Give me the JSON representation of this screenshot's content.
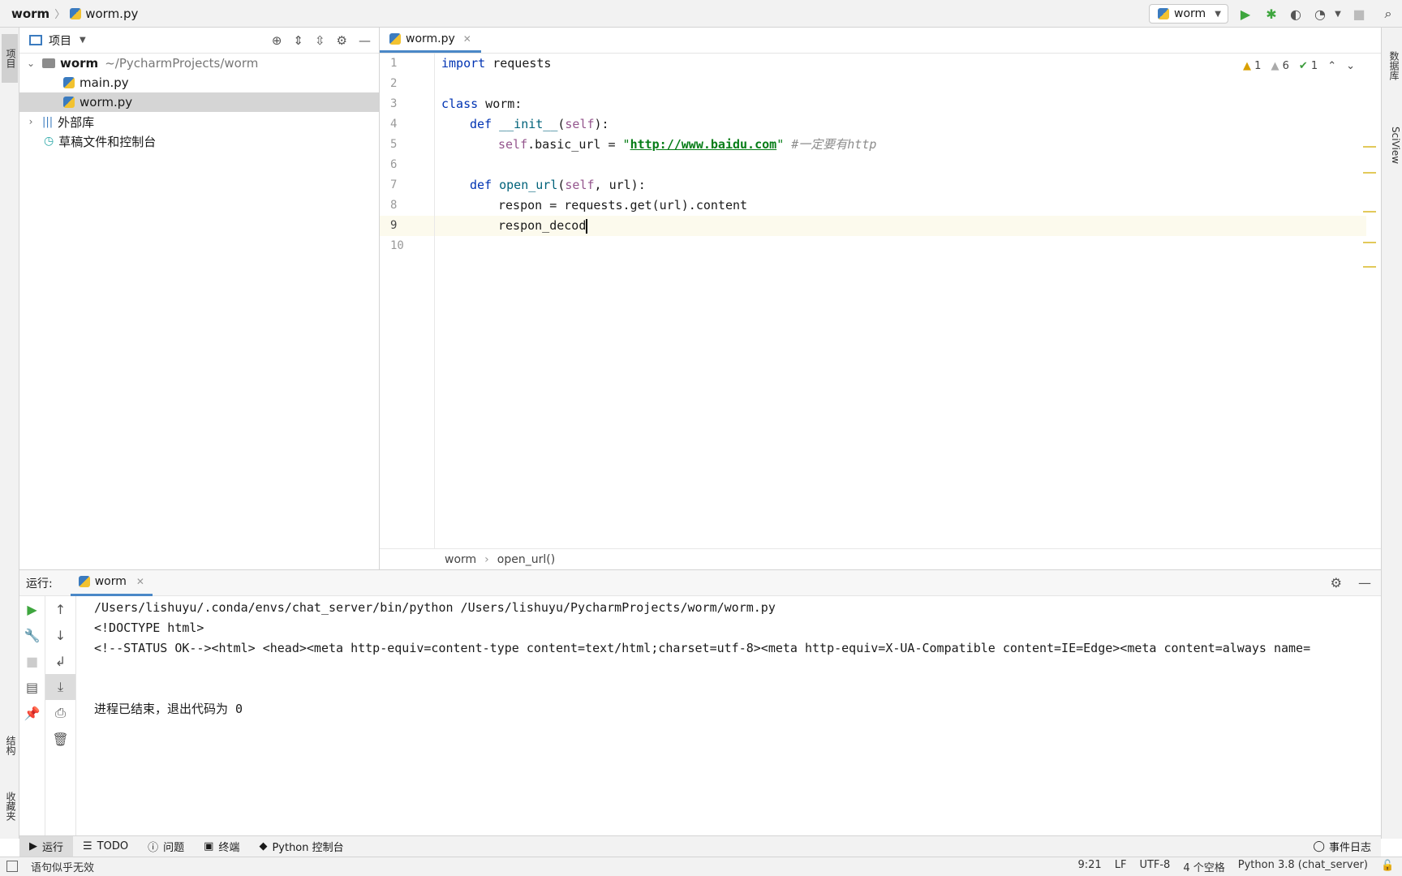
{
  "navbar": {
    "project": "worm",
    "file": "worm.py",
    "run_config": "worm"
  },
  "left_stripe": {
    "project_tab": "项目",
    "structure_tab": "结构",
    "favorites_tab": "收藏夹"
  },
  "right_stripe": {
    "database_tab": "数据库",
    "sciview_tab": "SciView"
  },
  "project_panel": {
    "title": "项目",
    "root_name": "worm",
    "root_path": "~/PycharmProjects/worm",
    "files": [
      "main.py",
      "worm.py"
    ],
    "selected_file": "worm.py",
    "external_libs": "外部库",
    "scratches": "草稿文件和控制台"
  },
  "editor": {
    "tab": "worm.py",
    "line_numbers": [
      "1",
      "2",
      "3",
      "4",
      "5",
      "6",
      "7",
      "8",
      "9",
      "10"
    ],
    "current_line": 9,
    "code": {
      "l1_kw": "import",
      "l1_rest": " requests",
      "l3_kw": "class",
      "l3_rest": " worm:",
      "l4_kw": "def",
      "l4_fn": "__init__",
      "l4_self": "self",
      "l5_self": "self",
      "l5_mid": ".basic_url = ",
      "l5_url": "http://www.baidu.com",
      "l5_comment": "#一定要有http",
      "l7_kw": "def",
      "l7_fn": "open_url",
      "l7_self": "self",
      "l7_rest": ", url):",
      "l8_text": "respon = requests.get(url).content",
      "l9_text": "respon_decod"
    },
    "inspections": {
      "errors": "1",
      "warnings": "6",
      "typos": "1"
    },
    "breadcrumb": [
      "worm",
      "open_url()"
    ]
  },
  "run_panel": {
    "label": "运行:",
    "tab": "worm",
    "console_lines": [
      "/Users/lishuyu/.conda/envs/chat_server/bin/python /Users/lishuyu/PycharmProjects/worm/worm.py",
      "<!DOCTYPE html>",
      "<!--STATUS OK--><html> <head><meta http-equiv=content-type content=text/html;charset=utf-8><meta http-equiv=X-UA-Compatible content=IE=Edge><meta content=always name=",
      "",
      "",
      "进程已结束，退出代码为 0"
    ]
  },
  "bottom_tools": {
    "run": "运行",
    "todo": "TODO",
    "problems": "问题",
    "terminal": "终端",
    "python_console": "Python 控制台",
    "event_log": "事件日志"
  },
  "statusbar": {
    "message": "语句似乎无效",
    "position": "9:21",
    "line_sep": "LF",
    "encoding": "UTF-8",
    "indent": "4 个空格",
    "interpreter": "Python 3.8 (chat_server)"
  }
}
